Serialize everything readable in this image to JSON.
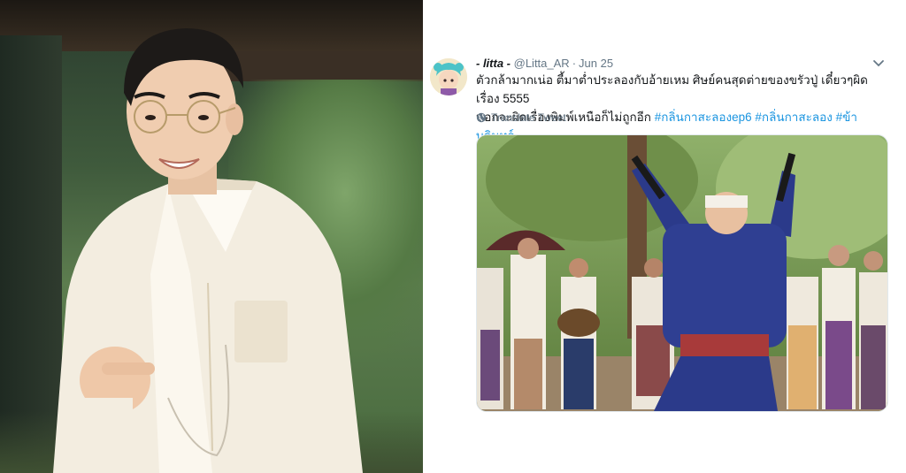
{
  "tweet": {
    "display_name": "- litta -",
    "handle": "@Litta_AR",
    "separator": "·",
    "date": "Jun 25",
    "text_line1": "ตัวกล้ามากเน่อ ตี้มาต่ำประลองกับอ้ายเหม ศิษย์คนสุดต่ายของขรัวปู่ เดี๋ยวๆผิดเรื่อง 5555",
    "text_line2_plain": "นอกจะผิดเรื่องพิมพ์เหนือก็ไม่ถูกอีก ",
    "hashtags": [
      "#กลิ่นกาสะลองep6",
      "#กลิ่นกาสะลอง",
      "#ข้าบดินทร์"
    ],
    "translate_label": "Translate Tweet",
    "icons": {
      "avatar": "avatar-anime-icon",
      "menu": "chevron-down-icon",
      "translate": "globe-icon"
    }
  },
  "colors": {
    "hashtag": "#1b95e0",
    "secondary_text": "#657786",
    "primary_text": "#14171a"
  }
}
